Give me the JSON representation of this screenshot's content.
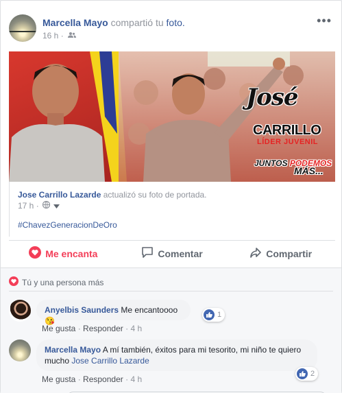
{
  "post": {
    "author": "Marcella Mayo",
    "action_text": "compartió tu",
    "object_text": "foto.",
    "time": "16 h ·",
    "audience_icon": "friends-icon",
    "more_icon": "•••"
  },
  "cover": {
    "title_line1": "José",
    "title_line2": "CARRILLO",
    "subtitle": "LÍDER JUVENIL",
    "slogan_a": "JUNTOS",
    "slogan_b": "PODEMOS",
    "slogan_c": "MÁS..."
  },
  "attachment": {
    "author": "Jose Carrillo Lazarde",
    "action_text": "actualizó su foto de portada.",
    "time": "17 h ·",
    "audience_icon": "globe-icon",
    "hashtag": "#ChavezGeneracionDeOro"
  },
  "actions": {
    "love_label": "Me encanta",
    "comment_label": "Comentar",
    "share_label": "Compartir"
  },
  "reactions": {
    "summary": "Tú y una persona más",
    "icon": "heart-icon"
  },
  "comments": [
    {
      "author": "Anyelbis Saunders",
      "text": "Me encantoooo",
      "emoji": "😘",
      "like_label": "Me gusta",
      "reply_label": "Responder",
      "time": "4 h",
      "likes": "1"
    },
    {
      "author": "Marcella Mayo",
      "text": "A mí también, éxitos para mi tesorito, mi niño te quiero mucho",
      "tag": "Jose Carrillo Lazarde",
      "like_label": "Me gusta",
      "reply_label": "Responder",
      "time": "4 h",
      "likes": "2"
    }
  ],
  "colors": {
    "link": "#365899",
    "meta": "#90949c",
    "love": "#f33e58",
    "like_badge": "#4267b2"
  }
}
